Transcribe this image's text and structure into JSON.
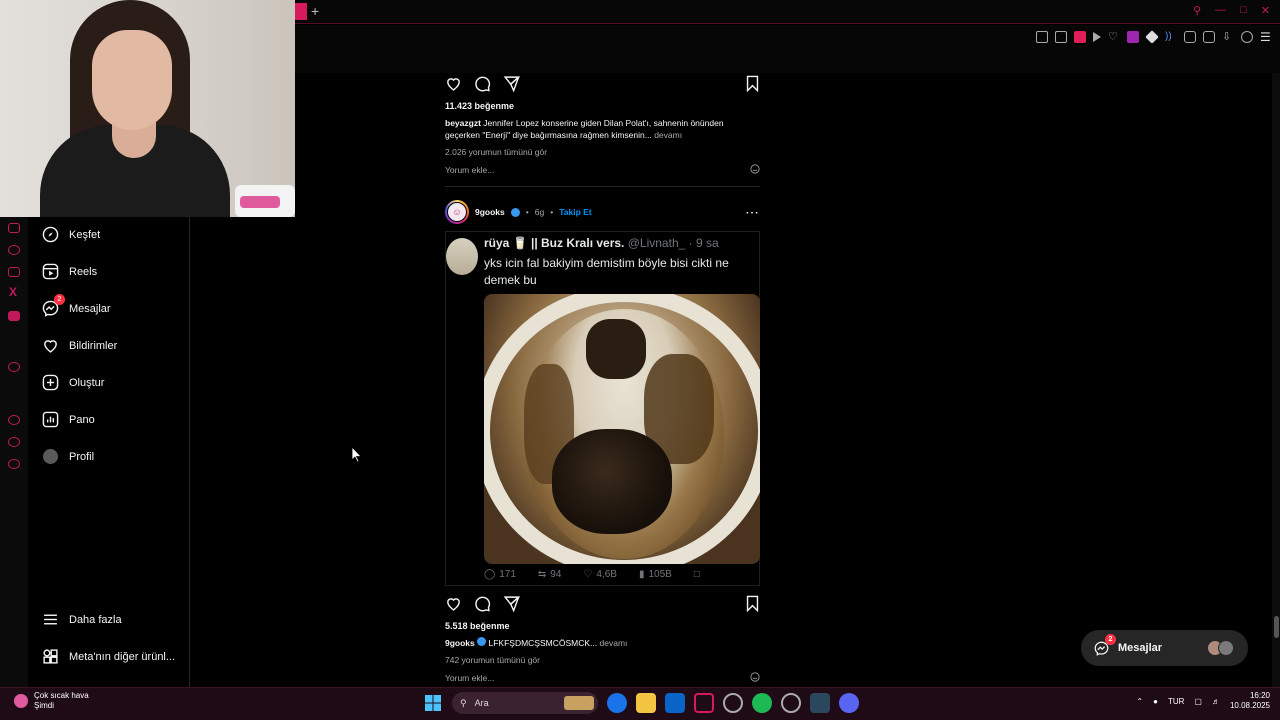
{
  "browser": {
    "new_tab_label": "+"
  },
  "sidebar": {
    "items": [
      {
        "label": "Keşfet",
        "icon": "compass-icon"
      },
      {
        "label": "Reels",
        "icon": "reels-icon"
      },
      {
        "label": "Mesajlar",
        "icon": "messenger-icon",
        "badge": "2"
      },
      {
        "label": "Bildirimler",
        "icon": "heart-icon"
      },
      {
        "label": "Oluştur",
        "icon": "plus-square-icon"
      },
      {
        "label": "Pano",
        "icon": "dashboard-icon"
      },
      {
        "label": "Profil",
        "icon": "avatar-icon"
      }
    ],
    "more_label": "Daha fazla",
    "meta_label": "Meta'nın diğer ürünl..."
  },
  "post1": {
    "likes": "11.423 beğenme",
    "username": "beyazgzt",
    "caption": "Jennifer Lopez konserine giden Dilan Polat'ı, sahnenin önünden geçerken \"Enerji\" diye bağırmasına rağmen kimsenin...",
    "more": "devamı",
    "comments_link": "2.026 yorumun tümünü gör",
    "add_comment": "Yorum ekle..."
  },
  "post2": {
    "username": "9gooks",
    "time": "6g",
    "follow": "Takip Et",
    "tweet": {
      "name": "rüya",
      "name_suffix": "|| Buz Kralı vers.",
      "handle": "@Livnath_ · 9 sa",
      "text": "yks icin fal bakiyim demistim böyle bisi cikti ne demek bu",
      "replies": "171",
      "retweets": "94",
      "likes": "4,6B",
      "views": "105B"
    },
    "likes": "5.518 beğenme",
    "caption_user": "9gooks",
    "caption": "LFKFŞDMCŞSMCÖSMCK...",
    "more": "devamı",
    "comments_link": "742 yorumun tümünü gör",
    "add_comment": "Yorum ekle..."
  },
  "messages_pill": {
    "label": "Mesajlar",
    "badge": "2"
  },
  "taskbar": {
    "weather_title": "Çok sıcak hava",
    "weather_sub": "Şimdi",
    "search_placeholder": "Ara",
    "lang": "TUR",
    "time": "16:20",
    "date": "10.08.2025"
  },
  "colors": {
    "accent": "#c2185b",
    "badge": "#ff3040",
    "follow": "#0095f6"
  }
}
